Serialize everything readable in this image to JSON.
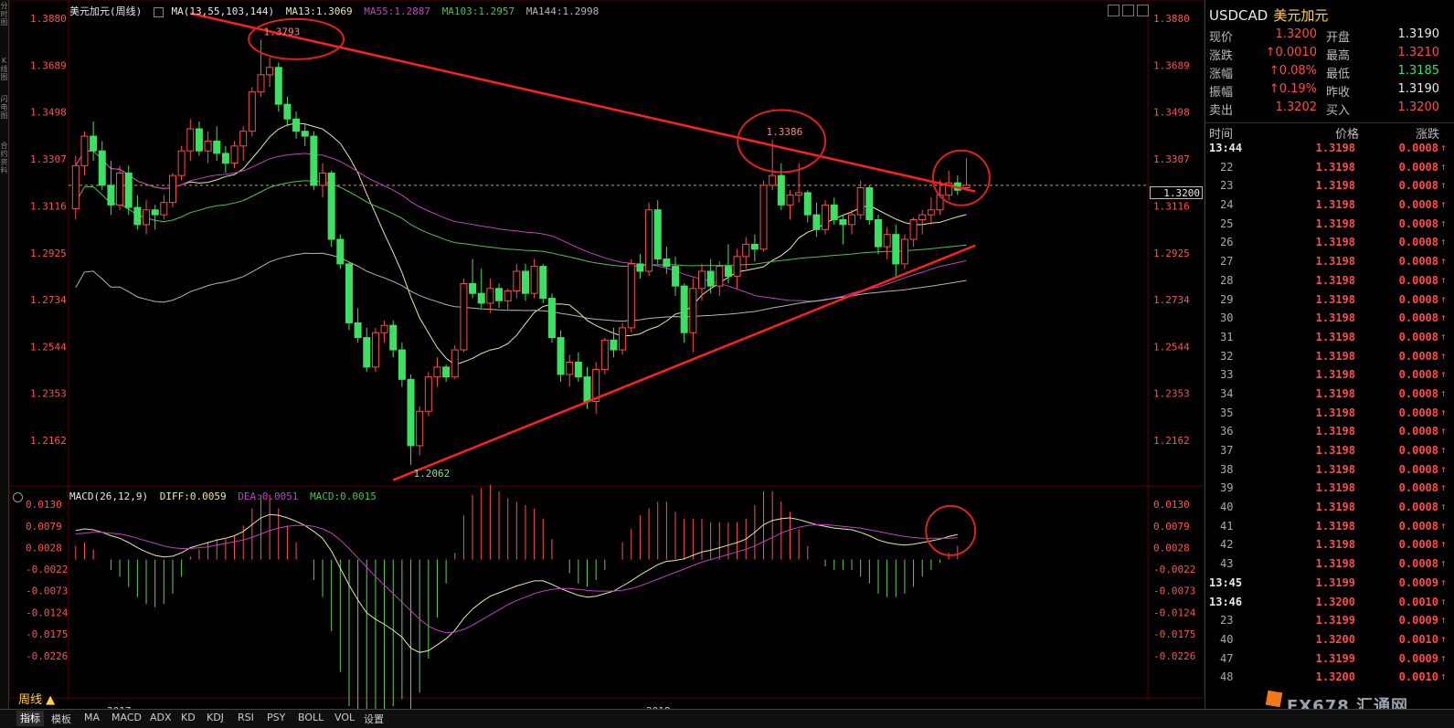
{
  "legend_main": {
    "title": "美元加元(周线)",
    "ma_params": "MA(13,55,103,144)",
    "ma13": "MA13:1.3069",
    "ma55": "MA55:1.2887",
    "ma103": "MA103:1.2957",
    "ma144": "MA144:1.2998"
  },
  "legend_macd": {
    "params": "MACD(26,12,9)",
    "diff": "DIFF:0.0059",
    "dea": "DEA:0.0051",
    "macd": "MACD:0.0015"
  },
  "left_strip": [
    "分时图",
    "K线图",
    "闪电图",
    "合约资料"
  ],
  "price_axis_labels": [
    "1.3880",
    "1.3689",
    "1.3498",
    "1.3307",
    "1.3116",
    "1.2925",
    "1.2734",
    "1.2544",
    "1.2353",
    "1.2162"
  ],
  "macd_axis_labels": [
    "0.0130",
    "0.0079",
    "0.0028",
    "-0.0022",
    "-0.0073",
    "-0.0124",
    "-0.0175",
    "-0.0226"
  ],
  "current_price_tag": "1.3200",
  "period_label": "周线 ▲",
  "year_labels": [
    "2017",
    "2018"
  ],
  "annotations": {
    "high1": "1.3793",
    "high2": "1.3386",
    "low1": "1.2062"
  },
  "colors": {
    "up": "#ff4a4a",
    "down": "#3ee063",
    "ma13": "#e8e8a0",
    "ma55": "#c040c0",
    "ma103": "#4ec04e",
    "ma144": "#b4b4b4",
    "trendline": "#ff2020",
    "macd_dea": "#c040c0"
  },
  "quote": {
    "symbol": "USDCAD",
    "name": "美元加元",
    "rows": [
      {
        "l1": "现价",
        "v1": "1.3200",
        "c1": "up",
        "l2": "开盘",
        "v2": "1.3190",
        "c2": "wh"
      },
      {
        "l1": "涨跌",
        "v1": "↑0.0010",
        "c1": "up",
        "l2": "最高",
        "v2": "1.3210",
        "c2": "up"
      },
      {
        "l1": "涨幅",
        "v1": "↑0.08%",
        "c1": "up",
        "l2": "最低",
        "v2": "1.3185",
        "c2": "dn"
      },
      {
        "l1": "振幅",
        "v1": "↑0.19%",
        "c1": "up",
        "l2": "昨收",
        "v2": "1.3190",
        "c2": "wh"
      },
      {
        "l1": "卖出",
        "v1": "1.3202",
        "c1": "up",
        "l2": "买入",
        "v2": "1.3200",
        "c2": "up"
      }
    ]
  },
  "ticks_header": {
    "time": "时间",
    "price": "价格",
    "change": "涨跌"
  },
  "ticks": [
    {
      "t": "13:44",
      "p": "1.3198",
      "c": "0.0008"
    },
    {
      "t": "22",
      "p": "1.3198",
      "c": "0.0008"
    },
    {
      "t": "23",
      "p": "1.3198",
      "c": "0.0008"
    },
    {
      "t": "24",
      "p": "1.3198",
      "c": "0.0008"
    },
    {
      "t": "25",
      "p": "1.3198",
      "c": "0.0008"
    },
    {
      "t": "26",
      "p": "1.3198",
      "c": "0.0008"
    },
    {
      "t": "27",
      "p": "1.3198",
      "c": "0.0008"
    },
    {
      "t": "28",
      "p": "1.3198",
      "c": "0.0008"
    },
    {
      "t": "29",
      "p": "1.3198",
      "c": "0.0008"
    },
    {
      "t": "30",
      "p": "1.3198",
      "c": "0.0008"
    },
    {
      "t": "31",
      "p": "1.3198",
      "c": "0.0008"
    },
    {
      "t": "32",
      "p": "1.3198",
      "c": "0.0008"
    },
    {
      "t": "33",
      "p": "1.3198",
      "c": "0.0008"
    },
    {
      "t": "34",
      "p": "1.3198",
      "c": "0.0008"
    },
    {
      "t": "35",
      "p": "1.3198",
      "c": "0.0008"
    },
    {
      "t": "36",
      "p": "1.3198",
      "c": "0.0008"
    },
    {
      "t": "37",
      "p": "1.3198",
      "c": "0.0008"
    },
    {
      "t": "38",
      "p": "1.3198",
      "c": "0.0008"
    },
    {
      "t": "39",
      "p": "1.3198",
      "c": "0.0008"
    },
    {
      "t": "40",
      "p": "1.3198",
      "c": "0.0008"
    },
    {
      "t": "41",
      "p": "1.3198",
      "c": "0.0008"
    },
    {
      "t": "42",
      "p": "1.3198",
      "c": "0.0008"
    },
    {
      "t": "43",
      "p": "1.3198",
      "c": "0.0008"
    },
    {
      "t": "13:45",
      "p": "1.3199",
      "c": "0.0009"
    },
    {
      "t": "13:46",
      "p": "1.3200",
      "c": "0.0010"
    },
    {
      "t": "23",
      "p": "1.3199",
      "c": "0.0009"
    },
    {
      "t": "40",
      "p": "1.3200",
      "c": "0.0010"
    },
    {
      "t": "47",
      "p": "1.3199",
      "c": "0.0009"
    },
    {
      "t": "48",
      "p": "1.3200",
      "c": "0.0010"
    }
  ],
  "bottom_tabs": [
    "指标",
    "模板",
    "MA",
    "MACD",
    "ADX",
    "KD",
    "KDJ",
    "RSI",
    "PSY",
    "BOLL",
    "VOL",
    "设置"
  ],
  "watermark": "FX678 汇通网",
  "chart_data": {
    "type": "candlestick",
    "title": "美元加元(周线)",
    "price_axis": {
      "min": 1.2062,
      "max": 1.388,
      "ticks": [
        1.388,
        1.3689,
        1.3498,
        1.3307,
        1.3116,
        1.2925,
        1.2734,
        1.2544,
        1.2353,
        1.2162
      ]
    },
    "current_price": 1.32,
    "ohlc": [
      [
        1.3105,
        1.332,
        1.306,
        1.328
      ],
      [
        1.328,
        1.342,
        1.324,
        1.34
      ],
      [
        1.34,
        1.346,
        1.33,
        1.334
      ],
      [
        1.334,
        1.338,
        1.318,
        1.32
      ],
      [
        1.32,
        1.33,
        1.308,
        1.312
      ],
      [
        1.312,
        1.328,
        1.31,
        1.325
      ],
      [
        1.325,
        1.328,
        1.308,
        1.311
      ],
      [
        1.311,
        1.316,
        1.302,
        1.304
      ],
      [
        1.304,
        1.314,
        1.3,
        1.31
      ],
      [
        1.31,
        1.312,
        1.302,
        1.308
      ],
      [
        1.308,
        1.316,
        1.306,
        1.313
      ],
      [
        1.313,
        1.325,
        1.311,
        1.324
      ],
      [
        1.324,
        1.336,
        1.322,
        1.334
      ],
      [
        1.334,
        1.347,
        1.33,
        1.343
      ],
      [
        1.343,
        1.346,
        1.332,
        1.334
      ],
      [
        1.334,
        1.342,
        1.329,
        1.338
      ],
      [
        1.338,
        1.344,
        1.33,
        1.333
      ],
      [
        1.333,
        1.336,
        1.325,
        1.329
      ],
      [
        1.329,
        1.338,
        1.327,
        1.336
      ],
      [
        1.336,
        1.344,
        1.33,
        1.342
      ],
      [
        1.342,
        1.36,
        1.34,
        1.358
      ],
      [
        1.358,
        1.3793,
        1.356,
        1.365
      ],
      [
        1.365,
        1.372,
        1.36,
        1.368
      ],
      [
        1.368,
        1.37,
        1.35,
        1.353
      ],
      [
        1.353,
        1.356,
        1.344,
        1.347
      ],
      [
        1.347,
        1.35,
        1.339,
        1.342
      ],
      [
        1.342,
        1.345,
        1.336,
        1.34
      ],
      [
        1.34,
        1.342,
        1.318,
        1.32
      ],
      [
        1.32,
        1.329,
        1.315,
        1.325
      ],
      [
        1.325,
        1.326,
        1.295,
        1.298
      ],
      [
        1.298,
        1.3,
        1.286,
        1.288
      ],
      [
        1.288,
        1.289,
        1.261,
        1.264
      ],
      [
        1.264,
        1.27,
        1.256,
        1.258
      ],
      [
        1.258,
        1.262,
        1.244,
        1.246
      ],
      [
        1.246,
        1.262,
        1.244,
        1.26
      ],
      [
        1.26,
        1.265,
        1.256,
        1.263
      ],
      [
        1.263,
        1.265,
        1.25,
        1.253
      ],
      [
        1.253,
        1.256,
        1.238,
        1.241
      ],
      [
        1.241,
        1.243,
        1.2062,
        1.214
      ],
      [
        1.214,
        1.23,
        1.21,
        1.228
      ],
      [
        1.228,
        1.244,
        1.226,
        1.242
      ],
      [
        1.242,
        1.25,
        1.238,
        1.246
      ],
      [
        1.246,
        1.247,
        1.24,
        1.242
      ],
      [
        1.242,
        1.255,
        1.241,
        1.253
      ],
      [
        1.253,
        1.282,
        1.252,
        1.28
      ],
      [
        1.28,
        1.29,
        1.274,
        1.276
      ],
      [
        1.276,
        1.286,
        1.27,
        1.272
      ],
      [
        1.272,
        1.282,
        1.268,
        1.278
      ],
      [
        1.278,
        1.28,
        1.27,
        1.273
      ],
      [
        1.273,
        1.278,
        1.269,
        1.277
      ],
      [
        1.277,
        1.288,
        1.274,
        1.285
      ],
      [
        1.285,
        1.288,
        1.273,
        1.276
      ],
      [
        1.276,
        1.29,
        1.274,
        1.287
      ],
      [
        1.287,
        1.288,
        1.272,
        1.274
      ],
      [
        1.274,
        1.276,
        1.256,
        1.258
      ],
      [
        1.258,
        1.261,
        1.24,
        1.243
      ],
      [
        1.243,
        1.251,
        1.238,
        1.248
      ],
      [
        1.248,
        1.252,
        1.24,
        1.242
      ],
      [
        1.242,
        1.246,
        1.229,
        1.232
      ],
      [
        1.232,
        1.248,
        1.227,
        1.245
      ],
      [
        1.245,
        1.258,
        1.243,
        1.257
      ],
      [
        1.257,
        1.262,
        1.25,
        1.253
      ],
      [
        1.253,
        1.264,
        1.251,
        1.262
      ],
      [
        1.262,
        1.29,
        1.26,
        1.288
      ],
      [
        1.288,
        1.292,
        1.282,
        1.285
      ],
      [
        1.285,
        1.313,
        1.283,
        1.31
      ],
      [
        1.31,
        1.314,
        1.288,
        1.29
      ],
      [
        1.29,
        1.295,
        1.284,
        1.287
      ],
      [
        1.287,
        1.291,
        1.275,
        1.279
      ],
      [
        1.279,
        1.28,
        1.256,
        1.26
      ],
      [
        1.26,
        1.282,
        1.252,
        1.278
      ],
      [
        1.278,
        1.288,
        1.273,
        1.285
      ],
      [
        1.285,
        1.29,
        1.276,
        1.279
      ],
      [
        1.279,
        1.289,
        1.275,
        1.287
      ],
      [
        1.287,
        1.296,
        1.28,
        1.283
      ],
      [
        1.283,
        1.294,
        1.278,
        1.291
      ],
      [
        1.291,
        1.299,
        1.286,
        1.296
      ],
      [
        1.296,
        1.3,
        1.289,
        1.294
      ],
      [
        1.294,
        1.322,
        1.293,
        1.32
      ],
      [
        1.32,
        1.3386,
        1.318,
        1.324
      ],
      [
        1.324,
        1.329,
        1.31,
        1.312
      ],
      [
        1.312,
        1.318,
        1.306,
        1.316
      ],
      [
        1.316,
        1.329,
        1.313,
        1.317
      ],
      [
        1.317,
        1.318,
        1.305,
        1.308
      ],
      [
        1.308,
        1.313,
        1.299,
        1.302
      ],
      [
        1.302,
        1.314,
        1.3,
        1.312
      ],
      [
        1.312,
        1.315,
        1.304,
        1.306
      ],
      [
        1.306,
        1.308,
        1.296,
        1.304
      ],
      [
        1.304,
        1.31,
        1.3,
        1.308
      ],
      [
        1.308,
        1.322,
        1.306,
        1.319
      ],
      [
        1.319,
        1.32,
        1.304,
        1.306
      ],
      [
        1.306,
        1.308,
        1.292,
        1.295
      ],
      [
        1.295,
        1.303,
        1.29,
        1.3
      ],
      [
        1.3,
        1.304,
        1.283,
        1.288
      ],
      [
        1.288,
        1.3,
        1.286,
        1.298
      ],
      [
        1.298,
        1.307,
        1.295,
        1.306
      ],
      [
        1.306,
        1.31,
        1.3,
        1.308
      ],
      [
        1.308,
        1.315,
        1.304,
        1.31
      ],
      [
        1.31,
        1.322,
        1.308,
        1.316
      ],
      [
        1.316,
        1.326,
        1.314,
        1.321
      ],
      [
        1.321,
        1.324,
        1.316,
        1.318
      ],
      [
        1.319,
        1.331,
        1.3185,
        1.32
      ]
    ],
    "macd": {
      "axis": {
        "min": -0.0226,
        "max": 0.013
      },
      "diff": [
        0.0068,
        0.0072,
        0.007,
        0.0064,
        0.0056,
        0.005,
        0.004,
        0.0028,
        0.0018,
        0.001,
        0.0006,
        0.0008,
        0.0016,
        0.0028,
        0.0034,
        0.004,
        0.0046,
        0.005,
        0.0056,
        0.0066,
        0.0082,
        0.0098,
        0.0106,
        0.0104,
        0.0098,
        0.009,
        0.008,
        0.0066,
        0.005,
        0.002,
        -0.002,
        -0.006,
        -0.0095,
        -0.0125,
        -0.014,
        -0.0152,
        -0.0166,
        -0.0182,
        -0.0208,
        -0.0218,
        -0.0214,
        -0.02,
        -0.0186,
        -0.0166,
        -0.0138,
        -0.0116,
        -0.01,
        -0.0086,
        -0.0078,
        -0.007,
        -0.0062,
        -0.0056,
        -0.005,
        -0.005,
        -0.0058,
        -0.0068,
        -0.0076,
        -0.0084,
        -0.0088,
        -0.0086,
        -0.008,
        -0.0074,
        -0.0062,
        -0.005,
        -0.0036,
        -0.0024,
        -0.0012,
        -0.0004,
        -0.0002,
        0.0002,
        0.001,
        0.0018,
        0.0022,
        0.0028,
        0.0034,
        0.004,
        0.0048,
        0.0064,
        0.0082,
        0.0092,
        0.0096,
        0.0098,
        0.0094,
        0.0088,
        0.0082,
        0.0078,
        0.0074,
        0.0072,
        0.007,
        0.0064,
        0.0056,
        0.0046,
        0.004,
        0.0036,
        0.0034,
        0.0036,
        0.004,
        0.0044,
        0.0048,
        0.0054,
        0.0059
      ],
      "dea": [
        0.006,
        0.0062,
        0.0064,
        0.0064,
        0.0062,
        0.006,
        0.0056,
        0.005,
        0.0044,
        0.0038,
        0.0032,
        0.0028,
        0.0026,
        0.0026,
        0.0028,
        0.003,
        0.0034,
        0.0038,
        0.0042,
        0.0046,
        0.0052,
        0.006,
        0.0068,
        0.0074,
        0.0078,
        0.008,
        0.008,
        0.0078,
        0.0072,
        0.0062,
        0.0046,
        0.0026,
        0.0004,
        -0.0018,
        -0.004,
        -0.006,
        -0.008,
        -0.01,
        -0.012,
        -0.014,
        -0.0156,
        -0.0166,
        -0.0172,
        -0.017,
        -0.0164,
        -0.0154,
        -0.0142,
        -0.013,
        -0.0118,
        -0.0106,
        -0.0096,
        -0.0088,
        -0.008,
        -0.0074,
        -0.007,
        -0.0068,
        -0.0068,
        -0.007,
        -0.0072,
        -0.0074,
        -0.0074,
        -0.0074,
        -0.0072,
        -0.0068,
        -0.0062,
        -0.0054,
        -0.0046,
        -0.0038,
        -0.003,
        -0.0022,
        -0.0014,
        -0.0006,
        0.0,
        0.0006,
        0.0012,
        0.0018,
        0.0024,
        0.0032,
        0.0042,
        0.0052,
        0.0062,
        0.007,
        0.0076,
        0.008,
        0.0082,
        0.0082,
        0.008,
        0.0078,
        0.0076,
        0.0074,
        0.007,
        0.0066,
        0.0062,
        0.0058,
        0.0054,
        0.0052,
        0.005,
        0.005,
        0.005,
        0.005,
        0.0051
      ]
    }
  }
}
